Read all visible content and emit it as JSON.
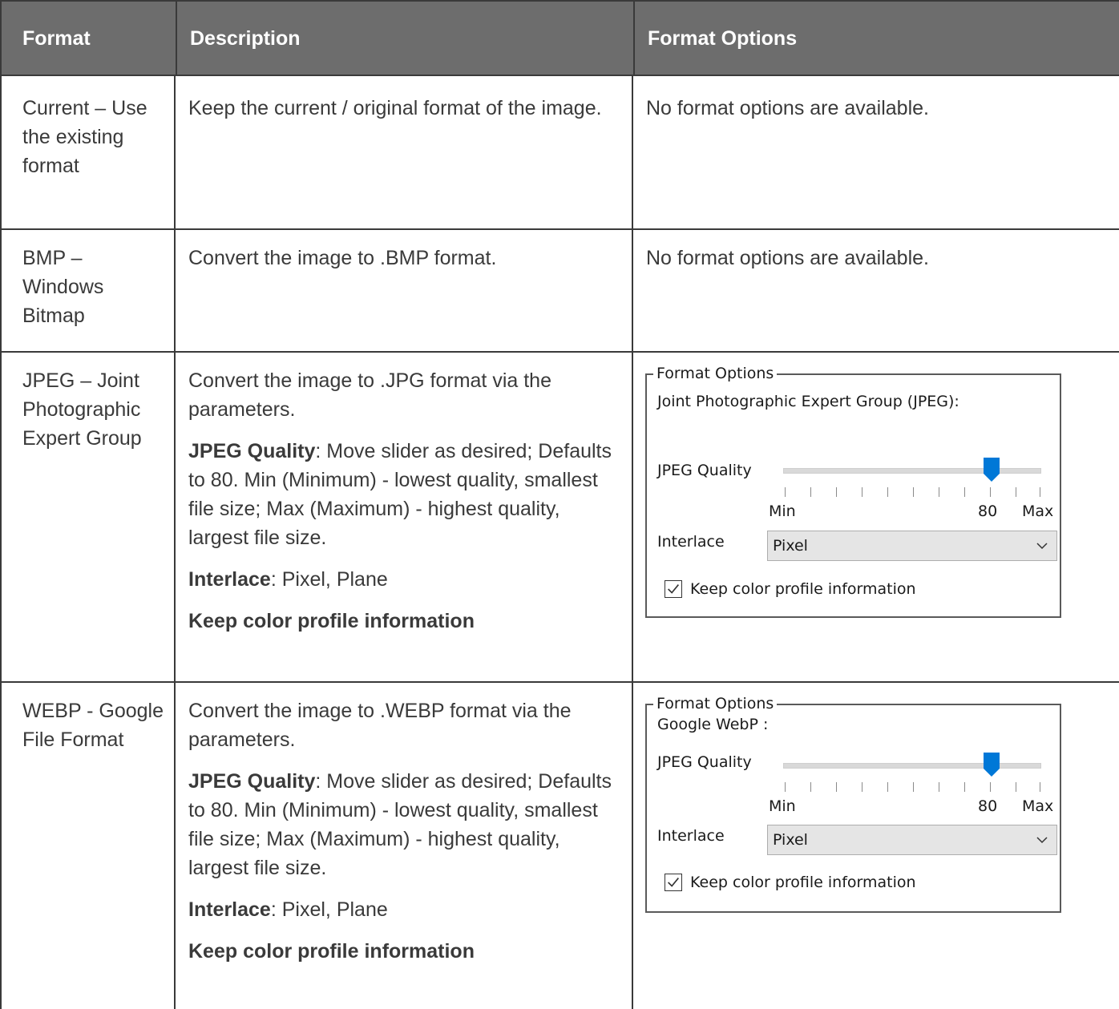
{
  "header": {
    "col_format": "Format",
    "col_description": "Description",
    "col_options": "Format Options"
  },
  "rows": [
    {
      "format": "Current – Use the existing format",
      "description": "Keep the current / original format of the image.",
      "options_text": "No format options are available."
    },
    {
      "format": "BMP – Windows Bitmap",
      "description": "Convert the image to .BMP format.",
      "options_text": "No format options are available."
    },
    {
      "format": "JPEG – Joint Photographic Expert Group",
      "description": "Convert the image to .JPG format via the parameters.",
      "quality_label": "JPEG Quality",
      "quality_text": ": Move slider as desired; Defaults to 80. Min (Minimum) - lowest quality, smallest file size; Max (Maximum) - highest quality, largest file size.",
      "interlace_label": "Interlace",
      "interlace_text": ": Pixel, Plane",
      "profile_label": "Keep color profile information",
      "panel": {
        "legend": "Format Options",
        "subtitle": "Joint Photographic Expert Group (JPEG):",
        "slider_label": "JPEG Quality",
        "slider_value": 80,
        "slider_min_label": "Min",
        "slider_value_label": "80",
        "slider_max_label": "Max",
        "interlace_label": "Interlace",
        "interlace_selected": "Pixel",
        "checkbox_label": "Keep color profile information",
        "checkbox_checked": true
      }
    },
    {
      "format": "WEBP - Google File Format",
      "description": "Convert the image to .WEBP format via the parameters.",
      "quality_label": "JPEG Quality",
      "quality_text": ": Move slider as desired; Defaults to 80. Min (Minimum) - lowest quality, smallest file size; Max (Maximum) - highest quality, largest file size.",
      "interlace_label": "Interlace",
      "interlace_text": ": Pixel, Plane",
      "profile_label": "Keep color profile information",
      "panel": {
        "legend": "Format Options",
        "subtitle": "Google WebP :",
        "slider_label": "JPEG Quality",
        "slider_value": 80,
        "slider_min_label": "Min",
        "slider_value_label": "80",
        "slider_max_label": "Max",
        "interlace_label": "Interlace",
        "interlace_selected": "Pixel",
        "checkbox_label": "Keep color profile information",
        "checkbox_checked": true
      }
    }
  ],
  "colors": {
    "header_bg": "#6d6d6d",
    "slider_thumb": "#0078d7"
  }
}
